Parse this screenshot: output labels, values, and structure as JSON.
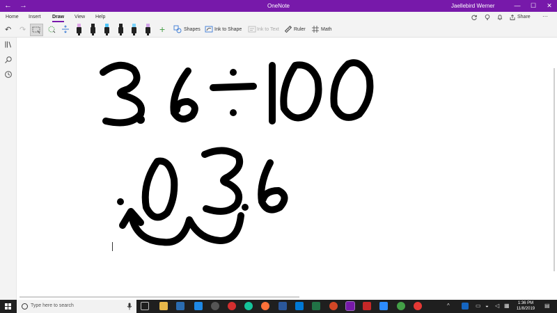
{
  "titlebar": {
    "app_title": "OneNote",
    "user_name": "Jaellebird Werner",
    "back_label": "←",
    "forward_label": "→",
    "minimize_label": "—",
    "maximize_label": "☐",
    "close_label": "✕"
  },
  "menu": {
    "tabs": [
      "Home",
      "Insert",
      "Draw",
      "View",
      "Help"
    ],
    "active_tab": "Draw",
    "share_label": "Share"
  },
  "ribbon": {
    "shapes_label": "Shapes",
    "ink_to_shape_label": "Ink to Shape",
    "ink_to_text_label": "Ink to Text",
    "ruler_label": "Ruler",
    "math_label": "Math",
    "pen_tip_colors": [
      "#e0a8e8",
      "#222222",
      "#4fc3f7",
      "#222222",
      "#7dd3fc",
      "#222222",
      "#d1a3e8",
      "#f7b9a8"
    ]
  },
  "ink": {
    "line1": [
      "3",
      ".",
      "6",
      "÷",
      "1",
      "0",
      "0"
    ],
    "line2": [
      ".",
      "0",
      "3",
      ".",
      "6"
    ],
    "ink_color": "#000000"
  },
  "taskbar": {
    "search_placeholder": "Type here to search",
    "time": "1:36 PM",
    "date": "11/8/2019"
  },
  "colors": {
    "accent": "#7719aa",
    "chrome": "#f3f3f3",
    "taskbar": "#1f1f1f"
  }
}
